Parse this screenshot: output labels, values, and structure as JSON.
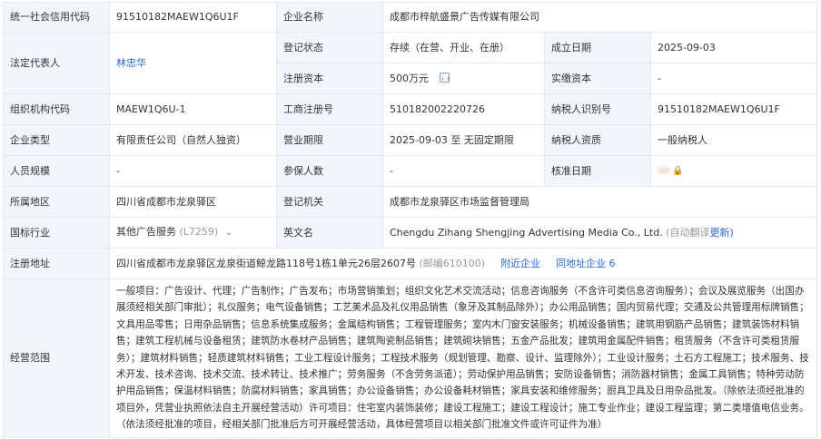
{
  "labels": {
    "credit_code": "统一社会信用代码",
    "company_name": "企业名称",
    "legal_rep": "法定代表人",
    "reg_status": "登记状态",
    "founded": "成立日期",
    "reg_capital": "注册资本",
    "paid_capital": "实缴资本",
    "org_code": "组织机构代码",
    "biz_reg_no": "工商注册号",
    "taxpayer_id": "纳税人识别号",
    "company_type": "企业类型",
    "biz_term": "营业期限",
    "taxpayer_qual": "纳税人资质",
    "staff_size": "人员规模",
    "insured_count": "参保人数",
    "approval_date": "核准日期",
    "region": "所属地区",
    "reg_authority": "登记机关",
    "industry": "国标行业",
    "english_name": "英文名",
    "address": "注册地址",
    "scope": "经营范围"
  },
  "values": {
    "credit_code": "91510182MAEW1Q6U1F",
    "company_name": "成都市梓航盛景广告传媒有限公司",
    "legal_rep": "林忠华",
    "reg_status": "存续（在营、开业、在册）",
    "founded": "2025-09-03",
    "reg_capital": "500万元",
    "paid_capital": "-",
    "org_code": "MAEW1Q6U-1",
    "biz_reg_no": "510182002220726",
    "taxpayer_id": "91510182MAEW1Q6U1F",
    "company_type": "有限责任公司（自然人独资）",
    "biz_term": "2025-09-03 至 无固定期限",
    "taxpayer_qual": "一般纳税人",
    "staff_size": "-",
    "insured_count": "-",
    "region": "四川省成都市龙泉驿区",
    "reg_authority": "成都市龙泉驿区市场监督管理局",
    "industry": "其他广告服务",
    "industry_code": "(L7259)",
    "english_name": "Chengdu Zihang Shengjing Advertising Media Co., Ltd.",
    "english_note": "(自动翻译",
    "english_more": "更新)",
    "address": "四川省成都市龙泉驿区龙泉街道鲸龙路118号1栋1单元26层2607号",
    "postcode": "(邮编610100)",
    "nearby_link": "附近企业",
    "same_addr_link": "同地址企业",
    "same_addr_count": "6",
    "scope": "一般项目：广告设计、代理；广告制作；广告发布；市场营销策划；组织文化艺术交流活动；信息咨询服务（不含许可类信息咨询服务）；会议及展览服务（出国办展须经相关部门审批）；礼仪服务；电气设备销售；工艺美术品及礼仪用品销售（象牙及其制品除外）；办公用品销售；国内贸易代理；交通及公共管理用标牌销售；文具用品零售；日用杂品销售；信息系统集成服务；金属结构销售；工程管理服务；室内木门窗安装服务；机械设备销售；建筑用钢筋产品销售；建筑装饰材料销售；建筑工程机械与设备租赁；建筑防水卷材产品销售；建筑陶瓷制品销售；建筑砌块销售；五金产品批发；建筑用金属配件销售；租赁服务（不含许可类租赁服务）；建筑材料销售；轻质建筑材料销售；工业工程设计服务；工程技术服务（规划管理、勘察、设计、监理除外）；工业设计服务；土石方工程施工；技术服务、技术开发、技术咨询、技术交流、技术转让、技术推广；劳务服务（不含劳务派遣）；劳动保护用品销售；安防设备销售；消防器材销售；金属工具销售；特种劳动防护用品销售；保温材料销售；防腐材料销售；家具销售；办公设备销售；办公设备耗材销售；家具安装和维修服务；厨具卫具及日用杂品批发。（除依法须经批准的项目外，凭营业执照依法自主开展经营活动）许可项目：住宅室内装饰装修；建设工程施工；建设工程设计；施工专业作业；建设工程监理；第二类增值电信业务。（依法须经批准的项目，经相关部门批准后方可开展经营活动，具体经营项目以相关部门批准文件或许可证件为准）"
  },
  "icons": {
    "capital_chart": "chart-icon",
    "industry_dropdown": "chevron-down-icon",
    "approval_lock": "lock-icon"
  },
  "colors": {
    "label_bg": "#f2f6fb",
    "border": "#e4e9f0",
    "link": "#2a6ad7"
  }
}
